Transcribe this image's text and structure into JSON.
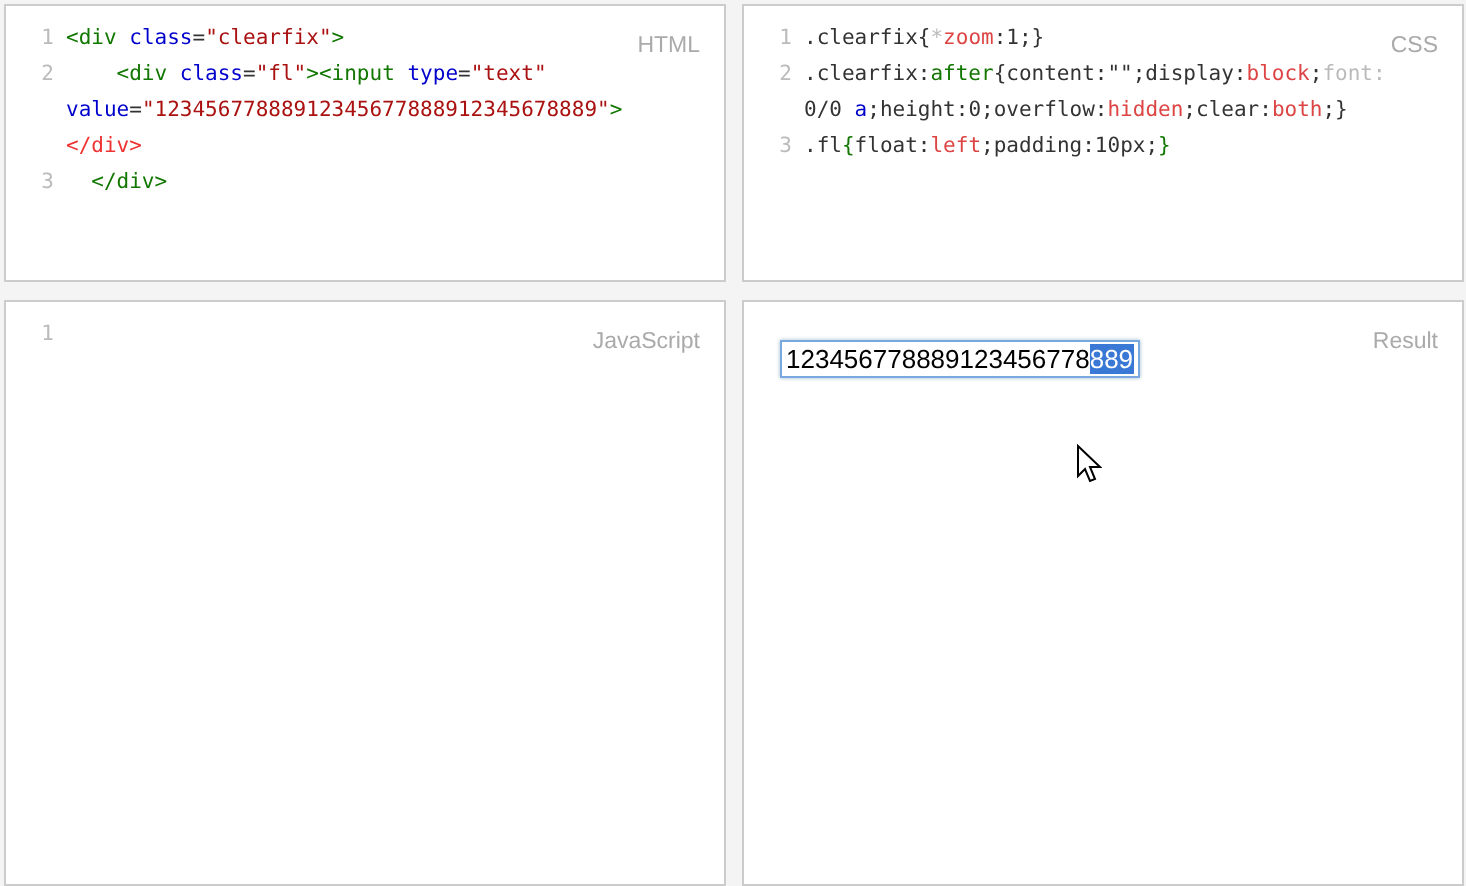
{
  "panes": [
    {
      "label": "HTML",
      "lines": [
        {
          "number": "1",
          "rows": [
            {
              "tokens": [
                {
                  "kind": "tag",
                  "text": "<div"
                },
                {
                  "kind": "attr",
                  "text": " class"
                },
                {
                  "kind": "plain",
                  "text": "="
                },
                {
                  "kind": "string",
                  "text": "\"clearfix\""
                },
                {
                  "kind": "tag",
                  "text": ">"
                }
              ]
            }
          ]
        },
        {
          "number": "2",
          "rows": [
            {
              "tokens": [
                {
                  "kind": "tag",
                  "text": "    <div"
                },
                {
                  "kind": "attr",
                  "text": " class"
                },
                {
                  "kind": "plain",
                  "text": "="
                },
                {
                  "kind": "string",
                  "text": "\"fl\""
                },
                {
                  "kind": "tag",
                  "text": "><input"
                },
                {
                  "kind": "attr",
                  "text": " type"
                },
                {
                  "kind": "plain",
                  "text": "="
                },
                {
                  "kind": "string",
                  "text": "\"text\""
                }
              ]
            },
            {
              "tokens": [
                {
                  "kind": "attr",
                  "text": "value"
                },
                {
                  "kind": "plain",
                  "text": "="
                },
                {
                  "kind": "string",
                  "text": "\"12345677888912345677888912345678889\""
                },
                {
                  "kind": "tag",
                  "text": ">"
                }
              ]
            },
            {
              "tokens": [
                {
                  "kind": "error",
                  "text": "</div>"
                }
              ]
            }
          ]
        },
        {
          "number": "3",
          "rows": [
            {
              "tokens": [
                {
                  "kind": "tag",
                  "text": "  </div>"
                }
              ]
            }
          ]
        }
      ]
    },
    {
      "label": "CSS",
      "lines": [
        {
          "number": "1",
          "rows": [
            {
              "tokens": [
                {
                  "kind": "plain",
                  "text": ".clearfix{"
                },
                {
                  "kind": "muted",
                  "text": "*"
                },
                {
                  "kind": "keyword",
                  "text": "zoom"
                },
                {
                  "kind": "plain",
                  "text": ":1;}"
                }
              ]
            }
          ]
        },
        {
          "number": "2",
          "rows": [
            {
              "tokens": [
                {
                  "kind": "plain",
                  "text": ".clearfix:"
                },
                {
                  "kind": "tag",
                  "text": "after"
                },
                {
                  "kind": "plain",
                  "text": "{content:\"\";display:"
                },
                {
                  "kind": "keyword",
                  "text": "block"
                },
                {
                  "kind": "plain",
                  "text": ";"
                },
                {
                  "kind": "muted",
                  "text": "font:"
                }
              ]
            },
            {
              "tokens": [
                {
                  "kind": "plain",
                  "text": "0/0 "
                },
                {
                  "kind": "attr",
                  "text": "a"
                },
                {
                  "kind": "plain",
                  "text": ";height:0;overflow:"
                },
                {
                  "kind": "keyword",
                  "text": "hidden"
                },
                {
                  "kind": "plain",
                  "text": ";clear:"
                },
                {
                  "kind": "keyword",
                  "text": "both"
                },
                {
                  "kind": "plain",
                  "text": ";}"
                }
              ]
            }
          ]
        },
        {
          "number": "3",
          "rows": [
            {
              "tokens": [
                {
                  "kind": "plain",
                  "text": ".fl"
                },
                {
                  "kind": "tag",
                  "text": "{"
                },
                {
                  "kind": "plain",
                  "text": "float:"
                },
                {
                  "kind": "keyword",
                  "text": "left"
                },
                {
                  "kind": "plain",
                  "text": ";padding:10px;"
                },
                {
                  "kind": "tag",
                  "text": "}"
                }
              ]
            }
          ]
        }
      ]
    },
    {
      "label": "JavaScript",
      "lines": [
        {
          "number": "1"
        }
      ]
    },
    {
      "label": "Result",
      "result": {
        "value": "123456778889123456778",
        "selection": "889"
      }
    }
  ]
}
